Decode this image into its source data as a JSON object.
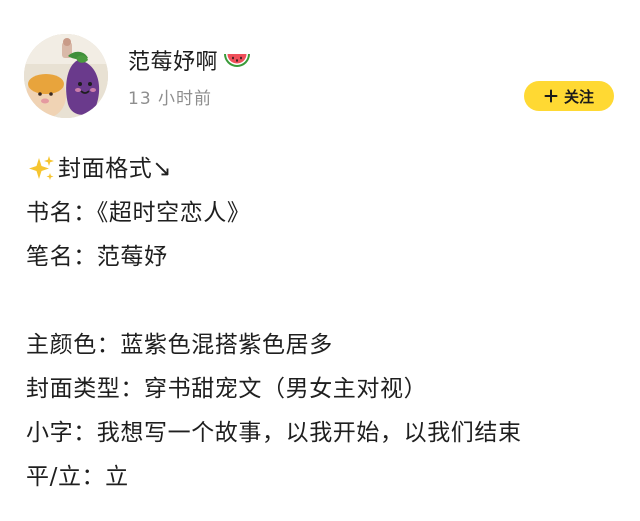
{
  "user": {
    "name": "范莓妤啊",
    "timestamp": "13 小时前",
    "avatar_icon": "avatar-plush-toys",
    "name_emoji": "watermelon-icon"
  },
  "follow": {
    "label": "关注",
    "icon": "plus-icon",
    "color": "#ffd933"
  },
  "post": {
    "heading_icon": "sparkles-icon",
    "heading": "封面格式↘",
    "lines": {
      "book_title": "书名：《超时空恋人》",
      "pen_name": "笔名：范莓妤",
      "main_color": "主颜色：蓝紫色混搭紫色居多",
      "cover_type": "封面类型：穿书甜宠文（男女主对视）",
      "small_text": "小字：我想写一个故事，以我开始，以我们结束",
      "orientation": "平/立：立"
    }
  },
  "colors": {
    "text": "#1f1f1f",
    "secondary_text": "#8e8e8e",
    "accent": "#ffd933"
  }
}
